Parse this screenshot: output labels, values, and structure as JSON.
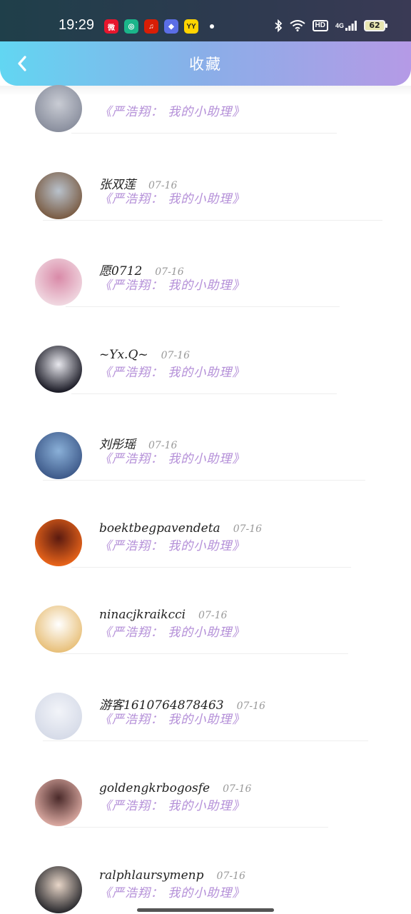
{
  "status_bar": {
    "time": "19:29",
    "apps": [
      {
        "name": "weibo-icon",
        "glyph": "微",
        "color": "#e6162d"
      },
      {
        "name": "app-circle-icon",
        "glyph": "◎",
        "color": "#1bb58a"
      },
      {
        "name": "netease-music-icon",
        "glyph": "♫",
        "color": "#d81e06"
      },
      {
        "name": "app-diamond-icon",
        "glyph": "◆",
        "color": "#5b6ee6"
      },
      {
        "name": "yy-icon",
        "glyph": "YY",
        "color": "#ffd400"
      }
    ],
    "network": "4G",
    "hd": "HD",
    "battery": "62"
  },
  "header": {
    "title": "收藏"
  },
  "items": [
    {
      "user": "",
      "date": "",
      "doc": "《严浩翔： 我的小助理》",
      "avatar_colors": [
        "#8a8f9e",
        "#c9ccd4"
      ]
    },
    {
      "user": "张双莲",
      "date": "07-16",
      "doc": "《严浩翔： 我的小助理》",
      "avatar_colors": [
        "#7a5c44",
        "#b9c2cc"
      ]
    },
    {
      "user": "愿0712",
      "date": "07-16",
      "doc": "《严浩翔： 我的小助理》",
      "avatar_colors": [
        "#f0d7e0",
        "#d98aa8"
      ]
    },
    {
      "user": "~Yx.Q~",
      "date": "07-16",
      "doc": "《严浩翔： 我的小助理》",
      "avatar_colors": [
        "#1b1b26",
        "#e8e8ee"
      ]
    },
    {
      "user": "刘彤瑶",
      "date": "07-16",
      "doc": "《严浩翔： 我的小助理》",
      "avatar_colors": [
        "#3e5a8a",
        "#8ab0d8"
      ]
    },
    {
      "user": "boektbegpavendeta",
      "date": "07-16",
      "doc": "《严浩翔： 我的小助理》",
      "avatar_colors": [
        "#e8641a",
        "#5a1a10"
      ]
    },
    {
      "user": "ninacjkraikcci",
      "date": "07-16",
      "doc": "《严浩翔： 我的小助理》",
      "avatar_colors": [
        "#e8c07a",
        "#ffffff"
      ]
    },
    {
      "user": "游客1610764878463",
      "date": "07-16",
      "doc": "《严浩翔： 我的小助理》",
      "avatar_colors": [
        "#d6dbe8",
        "#f2f4f9"
      ]
    },
    {
      "user": "goldengkrbogosfe",
      "date": "07-16",
      "doc": "《严浩翔： 我的小助理》",
      "avatar_colors": [
        "#d9a8a0",
        "#4a2a2a"
      ]
    },
    {
      "user": "ralphlaursymenp",
      "date": "07-16",
      "doc": "《严浩翔： 我的小助理》",
      "avatar_colors": [
        "#2a2a2e",
        "#e8d6c8"
      ]
    }
  ]
}
